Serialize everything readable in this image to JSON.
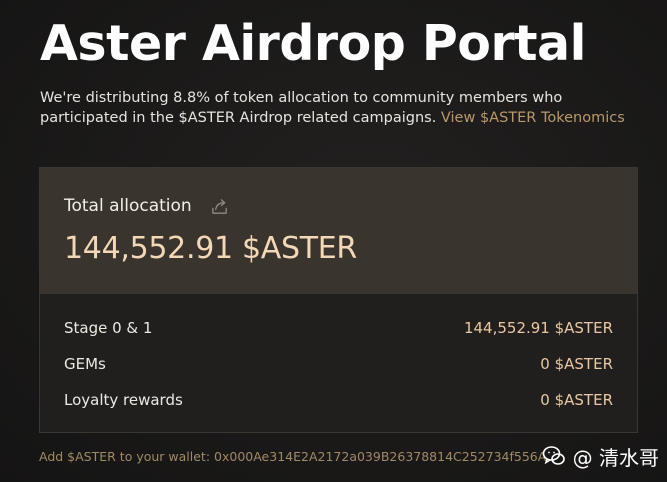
{
  "header": {
    "title": "Aster Airdrop Portal",
    "description": "We're distributing 8.8% of token allocation to community members who participated in the $ASTER Airdrop related campaigns.",
    "tokenomics_link": "View $ASTER Tokenomics"
  },
  "allocation": {
    "label": "Total allocation",
    "share_icon": "share-icon",
    "value": "144,552.91 $ASTER",
    "rows": [
      {
        "label": "Stage 0 & 1",
        "value": "144,552.91 $ASTER"
      },
      {
        "label": "GEMs",
        "value": "0 $ASTER"
      },
      {
        "label": "Loyalty rewards",
        "value": "0 $ASTER"
      }
    ]
  },
  "wallet": {
    "text": "Add $ASTER to your wallet: 0x000Ae314E2A2172a039B26378814C252734f556A"
  },
  "watermark": {
    "text": "@ 清水哥",
    "icon": "weixin-icon"
  },
  "colors": {
    "background": "#1a1918",
    "card_header": "#3a342e",
    "accent_value": "#f3d8b7",
    "link": "#b8996c"
  }
}
